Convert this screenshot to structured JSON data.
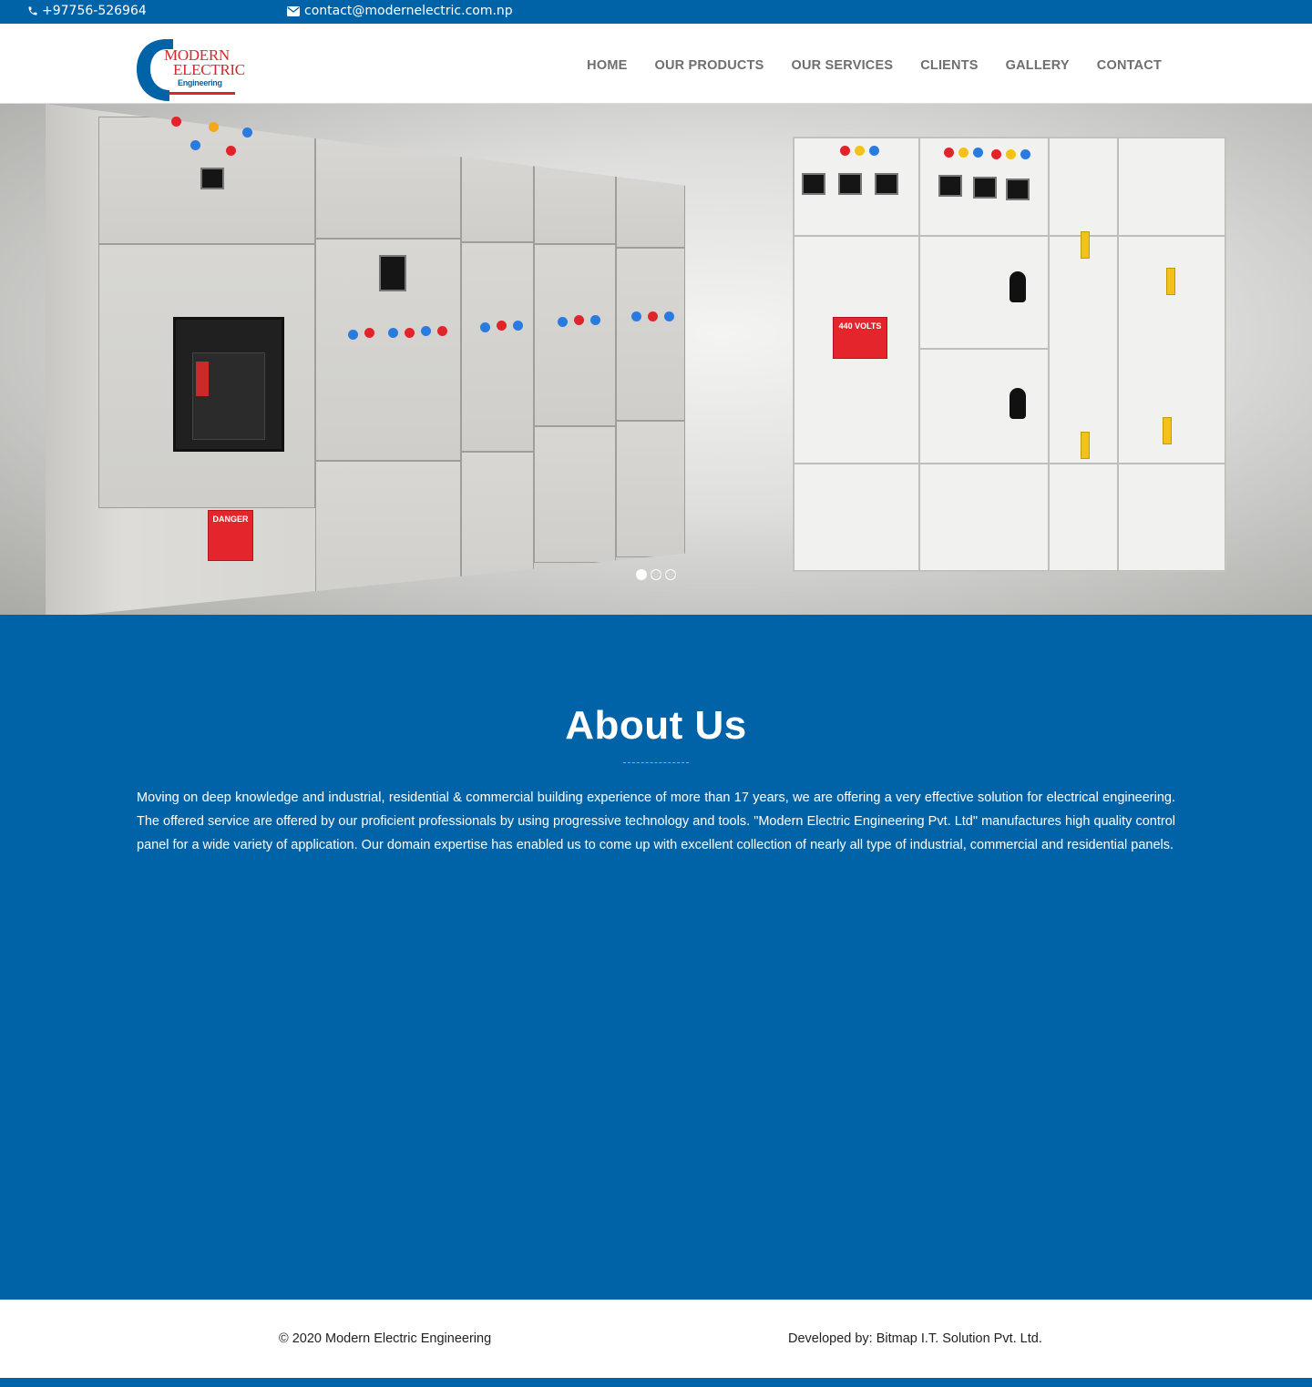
{
  "topbar": {
    "phone": "+97756-526964",
    "email": "contact@modernelectric.com.np",
    "phone_icon": "phone-icon",
    "email_icon": "envelope-icon"
  },
  "brand": {
    "logo_line1": "MODERN",
    "logo_line2": "ELECTRIC",
    "logo_line3": "Engineering",
    "logo_red": "#d7262d",
    "logo_blue": "#0063a8"
  },
  "nav": {
    "items": [
      {
        "label": "HOME"
      },
      {
        "label": "OUR PRODUCTS"
      },
      {
        "label": "OUR SERVICES"
      },
      {
        "label": "CLIENTS"
      },
      {
        "label": "GALLERY"
      },
      {
        "label": "CONTACT"
      }
    ]
  },
  "hero": {
    "slide_count": 3,
    "active_slide": 1,
    "danger_label": "DANGER",
    "danger_volts": "440 VOLTS"
  },
  "about": {
    "title": "About Us",
    "body": "Moving on deep knowledge and industrial, residential & commercial building experience of more than 17 years, we are offering a very effective solution for electrical engineering. The offered service are offered by our proficient professionals by using progressive technology and tools. \"Modern Electric Engineering Pvt. Ltd\" manufactures high quality control panel for a wide variety of application. Our domain expertise has enabled us to come up with excellent collection of nearly all type of industrial, commercial and residential panels."
  },
  "footer": {
    "copyright": "© 2020 Modern Electric Engineering",
    "developer": "Developed by: Bitmap I.T. Solution Pvt. Ltd."
  },
  "colors": {
    "primary": "#0063a8",
    "nav_text": "#6e6e6e",
    "white": "#ffffff"
  }
}
